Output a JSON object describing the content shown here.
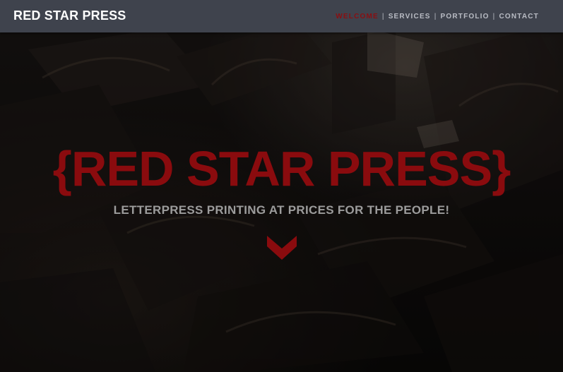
{
  "nav": {
    "brand": "RED STAR PRESS",
    "items": [
      {
        "label": "WELCOME",
        "active": true
      },
      {
        "label": "SERVICES",
        "active": false
      },
      {
        "label": "PORTFOLIO",
        "active": false
      },
      {
        "label": "CONTACT",
        "active": false
      }
    ],
    "separator": "|"
  },
  "hero": {
    "headline": "{RED STAR PRESS}",
    "tagline": "LETTERPRESS PRINTING AT PRICES FOR THE PEOPLE!",
    "scroll_icon": "chevron-down-icon"
  },
  "colors": {
    "navbar_bg": "#3f434d",
    "accent_red": "#8a0b0e",
    "nav_text": "#b9bcc4",
    "tagline_text": "#9c9c9c"
  }
}
